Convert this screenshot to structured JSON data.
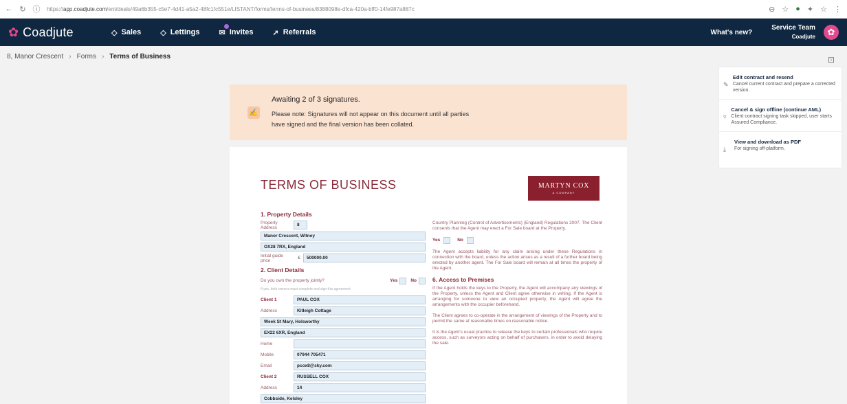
{
  "browser": {
    "url_prefix": "https://",
    "url_domain": "app.coadjute.com",
    "url_rest": "/ent/deals/49a6b355-c5e7-4d41-a5a2-48fc1fc551e/LISTANT/forms/terms-of-business/8388098e-dfca-420a-bff0-14fe987a887c"
  },
  "nav": {
    "brand": "Coadjute",
    "items": [
      {
        "label": "Sales",
        "icon": "tag-icon"
      },
      {
        "label": "Lettings",
        "icon": "tag-icon"
      },
      {
        "label": "Invites",
        "icon": "envelope-icon"
      },
      {
        "label": "Referrals",
        "icon": "send-icon"
      }
    ],
    "whats_new": "What's new?",
    "team_name": "Service Team",
    "team_org": "Coadjute"
  },
  "breadcrumb": {
    "items": [
      "8, Manor Crescent",
      "Forms"
    ],
    "current": "Terms of Business"
  },
  "actions": [
    {
      "title": "Edit contract and resend",
      "desc": "Cancel current contract and prepare a corrected version.",
      "icon": "edit-icon"
    },
    {
      "title": "Cancel & sign offline (continue AML)",
      "desc": "Client contract signing task skipped, user starts Assured Compliance.",
      "icon": "filter-icon"
    },
    {
      "title": "View and download as PDF",
      "desc": "For signing off-platform.",
      "icon": "download-icon"
    }
  ],
  "notice": {
    "title": "Awaiting 2 of 3 signatures.",
    "text": "Please note: Signatures will not appear on this document until all parties have signed and the final version has been collated."
  },
  "document": {
    "title": "TERMS OF BUSINESS",
    "logo_name": "MARTYN COX",
    "logo_sub": "& COMPANY",
    "property": {
      "section": "1. Property Details",
      "address_label": "Property Address",
      "number": "8",
      "line2": "Manor Crescent, Witney",
      "line3": "OX28 7RX, England",
      "price_label": "Initial guide price",
      "currency": "£",
      "price": "500000.00"
    },
    "client": {
      "section": "2. Client Details",
      "joint_question": "Do you own the property jointly?",
      "yes": "Yes",
      "no": "No",
      "hint": "If yes, both owners must complete and sign this agreement",
      "client1_label": "Client 1",
      "client1_name": "PAUL COX",
      "address_label": "Address",
      "client1_addr1": "Kitleigh Cottage",
      "client1_addr2": "Week St Mary, Holsworthy",
      "client1_addr3": "EX22 6XR, England",
      "home_label": "Home",
      "home_value": "",
      "mobile_label": "Mobile",
      "mobile_value": "07944 705471",
      "email_label": "Email",
      "email_value": "pcox8@sky.com",
      "client2_label": "Client 2",
      "client2_name": "RUSSELL COX",
      "client2_addr1": "14",
      "client2_addr2": "Cobbside, Kelsley"
    },
    "right": {
      "p1": "Country Planning (Control of Advertisements) (England) Regulations 2007. The Client consents that the Agent may erect a For Sale board at the Property.",
      "yes": "Yes",
      "no": "No",
      "p2": "The Agent accepts liability for any claim arising under these Regulations in connection with the board, unless the action arises as a result of a further board being erected by another agent. The For Sale board will remain at all times the property of the Agent.",
      "section": "6. Access to Premises",
      "p3": "If the Agent holds the keys to the Property, the Agent will accompany any viewings of the Property, unless the Agent and Client agree otherwise in writing. If the Agent is arranging for someone to view an occupied property, the Agent will agree the arrangements with the occupier beforehand.",
      "p4": "The Client agrees to co-operate in the arrangement of viewings of the Property and to permit the same at reasonable times on reasonable notice.",
      "p5": "It is the Agent's usual practice to release the keys to certain professionals who require access, such as surveyors acting on behalf of purchasers, in order to avoid delaying the sale."
    }
  }
}
